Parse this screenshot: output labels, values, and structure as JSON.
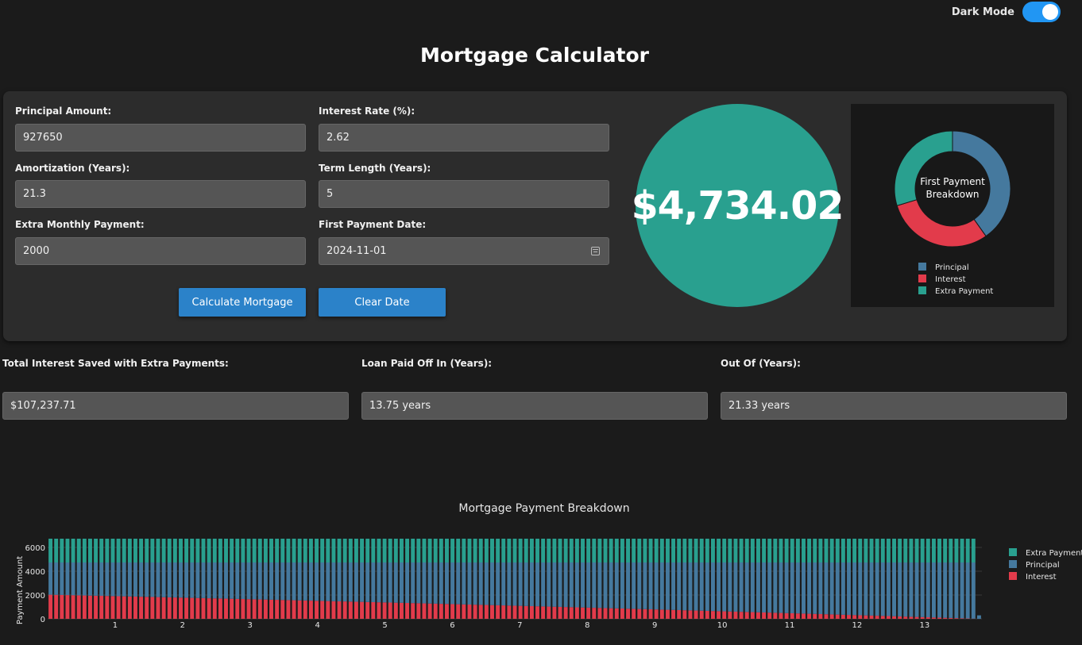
{
  "dark_mode": {
    "label": "Dark Mode",
    "on": true
  },
  "title": "Mortgage Calculator",
  "form": {
    "principal": {
      "label": "Principal Amount:",
      "value": "927650"
    },
    "interest_rate": {
      "label": "Interest Rate (%):",
      "value": "2.62"
    },
    "amortization": {
      "label": "Amortization (Years):",
      "value": "21.3"
    },
    "term_length": {
      "label": "Term Length (Years):",
      "value": "5"
    },
    "extra_payment": {
      "label": "Extra Monthly Payment:",
      "value": "2000"
    },
    "first_payment_date": {
      "label": "First Payment Date:",
      "value": "2024-11-01"
    },
    "calculate_label": "Calculate Mortgage",
    "clear_label": "Clear Date"
  },
  "monthly_payment": "$4,734.02",
  "donut": {
    "title_line1": "First Payment",
    "title_line2": "Breakdown",
    "slices": [
      {
        "name": "Principal",
        "value": 2708.6,
        "color": "#45799e"
      },
      {
        "name": "Interest",
        "value": 2025.4,
        "color": "#e23b4b"
      },
      {
        "name": "Extra Payment",
        "value": 2000,
        "color": "#29a08f"
      }
    ]
  },
  "stats": {
    "interest_saved": {
      "label": "Total Interest Saved with Extra Payments:",
      "value": "$107,237.71"
    },
    "paid_off_in": {
      "label": "Loan Paid Off In (Years):",
      "value": "13.75 years"
    },
    "out_of": {
      "label": "Out Of (Years):",
      "value": "21.33 years"
    }
  },
  "chart_data": {
    "type": "bar",
    "title": "Mortgage Payment Breakdown",
    "ylabel": "Payment Amount",
    "xlabel": "",
    "stacked": true,
    "x_ticks": [
      "1",
      "2",
      "3",
      "4",
      "5",
      "6",
      "7",
      "8",
      "9",
      "10",
      "11",
      "12",
      "13"
    ],
    "y_ticks": [
      "0",
      "2000",
      "4000",
      "6000"
    ],
    "ylim": [
      0,
      7000
    ],
    "xlim": [
      0,
      13.85
    ],
    "months": 165,
    "monthly_total": 4734.02,
    "extra_payment": 2000,
    "annual_rate_pct": 2.62,
    "initial_balance": 927650,
    "legend": [
      "Extra Payment",
      "Principal",
      "Interest"
    ],
    "legend_position": "right",
    "series": [
      {
        "name": "Extra Payment",
        "color": "#29a08f"
      },
      {
        "name": "Principal",
        "color": "#45799e"
      },
      {
        "name": "Interest",
        "color": "#e23b4b"
      }
    ]
  }
}
